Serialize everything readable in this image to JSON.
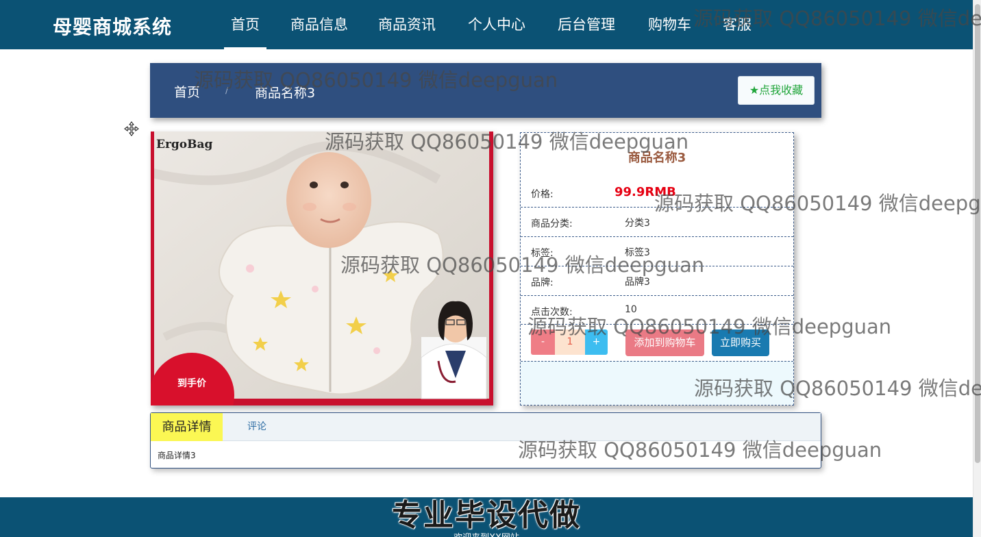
{
  "header": {
    "logo": "母婴商城系统",
    "nav": [
      "首页",
      "商品信息",
      "商品资讯",
      "个人中心",
      "后台管理",
      "购物车",
      "客服"
    ]
  },
  "breadcrumb": {
    "home": "首页",
    "separator": "/",
    "current": "商品名称3",
    "favorite_button": "★点我收藏"
  },
  "product": {
    "image_brand": "ErgoBag",
    "image_price_badge": "到手价",
    "title": "商品名称3",
    "price_label": "价格:",
    "price": "99.9RMB",
    "category_label": "商品分类:",
    "category": "分类3",
    "tag_label": "标签:",
    "tag": "标签3",
    "brand_label": "品牌:",
    "brand": "品牌3",
    "clicks_label": "点击次数:",
    "clicks": "10",
    "qty_minus": "-",
    "qty_value": "1",
    "qty_plus": "+",
    "add_to_cart": "添加到购物车",
    "buy_now": "立即购买"
  },
  "tabs": {
    "details": "商品详情",
    "comments": "评论",
    "body": "商品详情3"
  },
  "footer": {
    "logo": "专业毕设代做",
    "text": "欢迎来到XX网站"
  },
  "watermark": "源码获取 QQ86050149 微信deepguan",
  "colors": {
    "header_bg": "#0b5274",
    "breadcrumb_bg": "#2f4f7f",
    "price": "#e60012",
    "title": "#9a5a3f",
    "add_to_cart": "#ea7a85",
    "buy_now": "#197ab0",
    "active_tab": "#fbf753"
  }
}
